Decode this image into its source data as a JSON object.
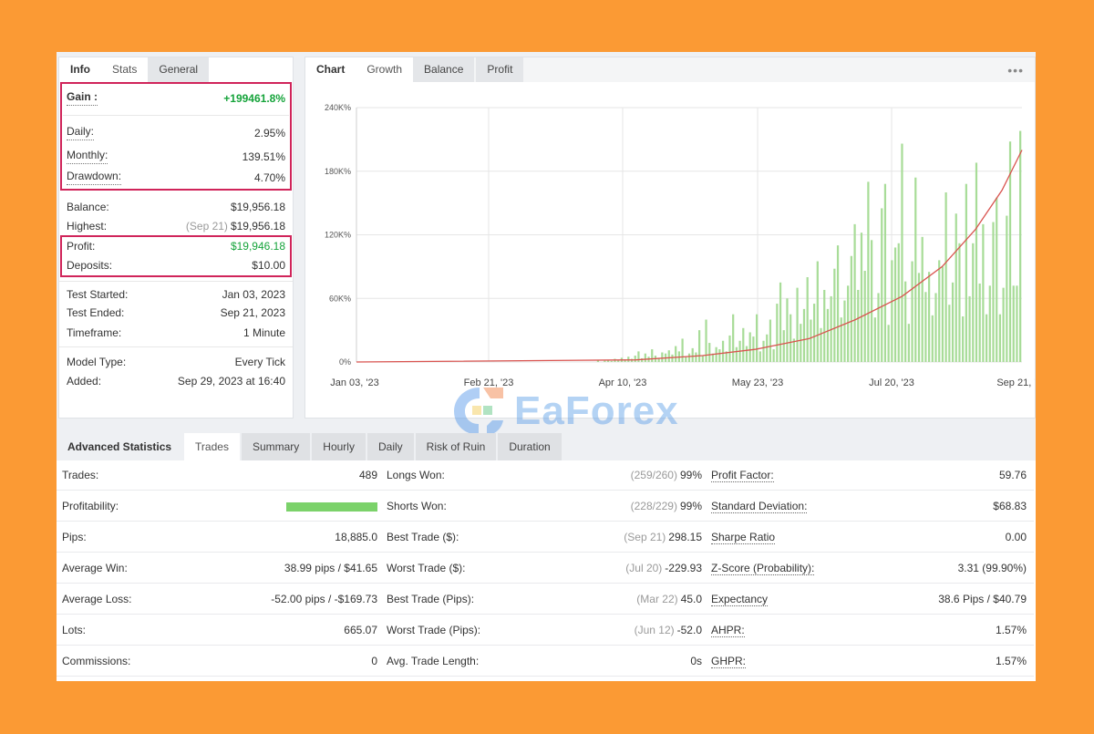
{
  "info": {
    "tabs": [
      "Info",
      "Stats",
      "General"
    ],
    "rows": [
      {
        "label": "Gain :",
        "value": "+199461.8%"
      },
      {
        "label": "Daily:",
        "value": "2.95%"
      },
      {
        "label": "Monthly:",
        "value": "139.51%"
      },
      {
        "label": "Drawdown:",
        "value": "4.70%"
      },
      {
        "label": "Balance:",
        "value": "$19,956.18"
      },
      {
        "label": "Highest:",
        "muted": "(Sep 21)",
        "value": "$19,956.18"
      },
      {
        "label": "Profit:",
        "value": "$19,946.18"
      },
      {
        "label": "Deposits:",
        "value": "$10.00"
      },
      {
        "label": "Test Started:",
        "value": "Jan 03, 2023"
      },
      {
        "label": "Test Ended:",
        "value": "Sep 21, 2023"
      },
      {
        "label": "Timeframe:",
        "value": "1 Minute"
      },
      {
        "label": "Model Type:",
        "value": "Every Tick"
      },
      {
        "label": "Added:",
        "value": "Sep 29, 2023 at 16:40"
      }
    ]
  },
  "chart": {
    "tabs": [
      "Chart",
      "Growth",
      "Balance",
      "Profit"
    ],
    "more": "•••"
  },
  "chart_data": {
    "type": "bar",
    "y_ticks": [
      "0%",
      "60K%",
      "120K%",
      "180K%",
      "240K%"
    ],
    "x_ticks": [
      "Jan 03, '23",
      "Feb 21, '23",
      "Apr 10, '23",
      "May 23, '23",
      "Jul 20, '23",
      "Sep 21, '23"
    ],
    "ylim": [
      0,
      240000
    ],
    "colors": {
      "bars": "#a8dc98",
      "line": "#d9534f",
      "grid": "#e6e6e6"
    },
    "series": [
      {
        "kind": "bar",
        "values": [
          0,
          0,
          0,
          0,
          0,
          0,
          0,
          0,
          0,
          0,
          0,
          0,
          0,
          0,
          0,
          0,
          0,
          0,
          0,
          0,
          0,
          0,
          0,
          0,
          0,
          0,
          0,
          0,
          0,
          0,
          0,
          0,
          0,
          0,
          0,
          0,
          0,
          0,
          0,
          0,
          0,
          0,
          0,
          0,
          0,
          0,
          0,
          0,
          0,
          0,
          0,
          0,
          0,
          0,
          0,
          0,
          0,
          0,
          0,
          0,
          0,
          0,
          0,
          0,
          0,
          0,
          0,
          0,
          0,
          0,
          0,
          1500,
          0,
          1200,
          2000,
          1000,
          3000,
          1500,
          4000,
          2500,
          5000,
          3000,
          6000,
          10000,
          3500,
          8000,
          5000,
          12000,
          6000,
          4000,
          9000,
          8000,
          11000,
          7000,
          15000,
          10000,
          22000,
          5000,
          8000,
          13000,
          9000,
          30000,
          6000,
          40000,
          18000,
          8000,
          14000,
          12000,
          20000,
          10000,
          25000,
          45000,
          14000,
          20000,
          32000,
          15000,
          28000,
          24000,
          45000,
          10000,
          20000,
          26000,
          40000,
          12000,
          55000,
          75000,
          30000,
          60000,
          45000,
          22000,
          70000,
          36000,
          50000,
          80000,
          40000,
          55000,
          95000,
          32000,
          68000,
          50000,
          62000,
          88000,
          110000,
          42000,
          58000,
          72000,
          100000,
          130000,
          68000,
          122000,
          86000,
          170000,
          115000,
          42000,
          65000,
          145000,
          168000,
          35000,
          96000,
          108000,
          112000,
          206000,
          76000,
          36000,
          95000,
          174000,
          84000,
          118000,
          66000,
          85000,
          44000,
          65000,
          96000,
          90000,
          160000,
          54000,
          75000,
          140000,
          112000,
          43000,
          168000,
          62000,
          112000,
          188000,
          74000,
          130000,
          45000,
          72000,
          132000,
          155000,
          45000,
          70000,
          138000,
          208000,
          72000,
          72000,
          218000
        ]
      },
      {
        "kind": "line",
        "points": [
          [
            0,
            0
          ],
          [
            0.42,
            2000
          ],
          [
            0.52,
            6000
          ],
          [
            0.6,
            12000
          ],
          [
            0.68,
            22000
          ],
          [
            0.75,
            40000
          ],
          [
            0.82,
            62000
          ],
          [
            0.88,
            90000
          ],
          [
            0.93,
            125000
          ],
          [
            0.97,
            162000
          ],
          [
            1.0,
            200000
          ]
        ]
      }
    ]
  },
  "watermark": "EaForex",
  "advanced": {
    "tabs": [
      "Advanced Statistics",
      "Trades",
      "Summary",
      "Hourly",
      "Daily",
      "Risk of Ruin",
      "Duration"
    ],
    "col1": [
      {
        "label": "Trades:",
        "value": "489"
      },
      {
        "label": "Profitability:",
        "bar": 1.0
      },
      {
        "label": "Pips:",
        "value": "18,885.0"
      },
      {
        "label": "Average Win:",
        "value": "38.99 pips / $41.65"
      },
      {
        "label": "Average Loss:",
        "value": "-52.00 pips / -$169.73"
      },
      {
        "label": "Lots:",
        "value": "665.07"
      },
      {
        "label": "Commissions:",
        "value": "0"
      }
    ],
    "col2": [
      {
        "label": "Longs Won:",
        "muted": "(259/260)",
        "value": "99%"
      },
      {
        "label": "Shorts Won:",
        "muted": "(228/229)",
        "value": "99%"
      },
      {
        "label": "Best Trade ($):",
        "muted": "(Sep 21)",
        "value": "298.15"
      },
      {
        "label": "Worst Trade ($):",
        "muted": "(Jul 20)",
        "value": "-229.93"
      },
      {
        "label": "Best Trade (Pips):",
        "muted": "(Mar 22)",
        "value": "45.0"
      },
      {
        "label": "Worst Trade (Pips):",
        "muted": "(Jun 12)",
        "value": "-52.0"
      },
      {
        "label": "Avg. Trade Length:",
        "value": "0s"
      }
    ],
    "col3": [
      {
        "label": "Profit Factor:",
        "value": "59.76"
      },
      {
        "label": "Standard Deviation:",
        "value": "$68.83"
      },
      {
        "label": "Sharpe Ratio",
        "value": "0.00"
      },
      {
        "label": "Z-Score (Probability):",
        "value": "3.31 (99.90%)"
      },
      {
        "label": "Expectancy",
        "value": "38.6 Pips / $40.79"
      },
      {
        "label": "AHPR:",
        "value": "1.57%"
      },
      {
        "label": "GHPR:",
        "value": "1.57%"
      }
    ]
  }
}
